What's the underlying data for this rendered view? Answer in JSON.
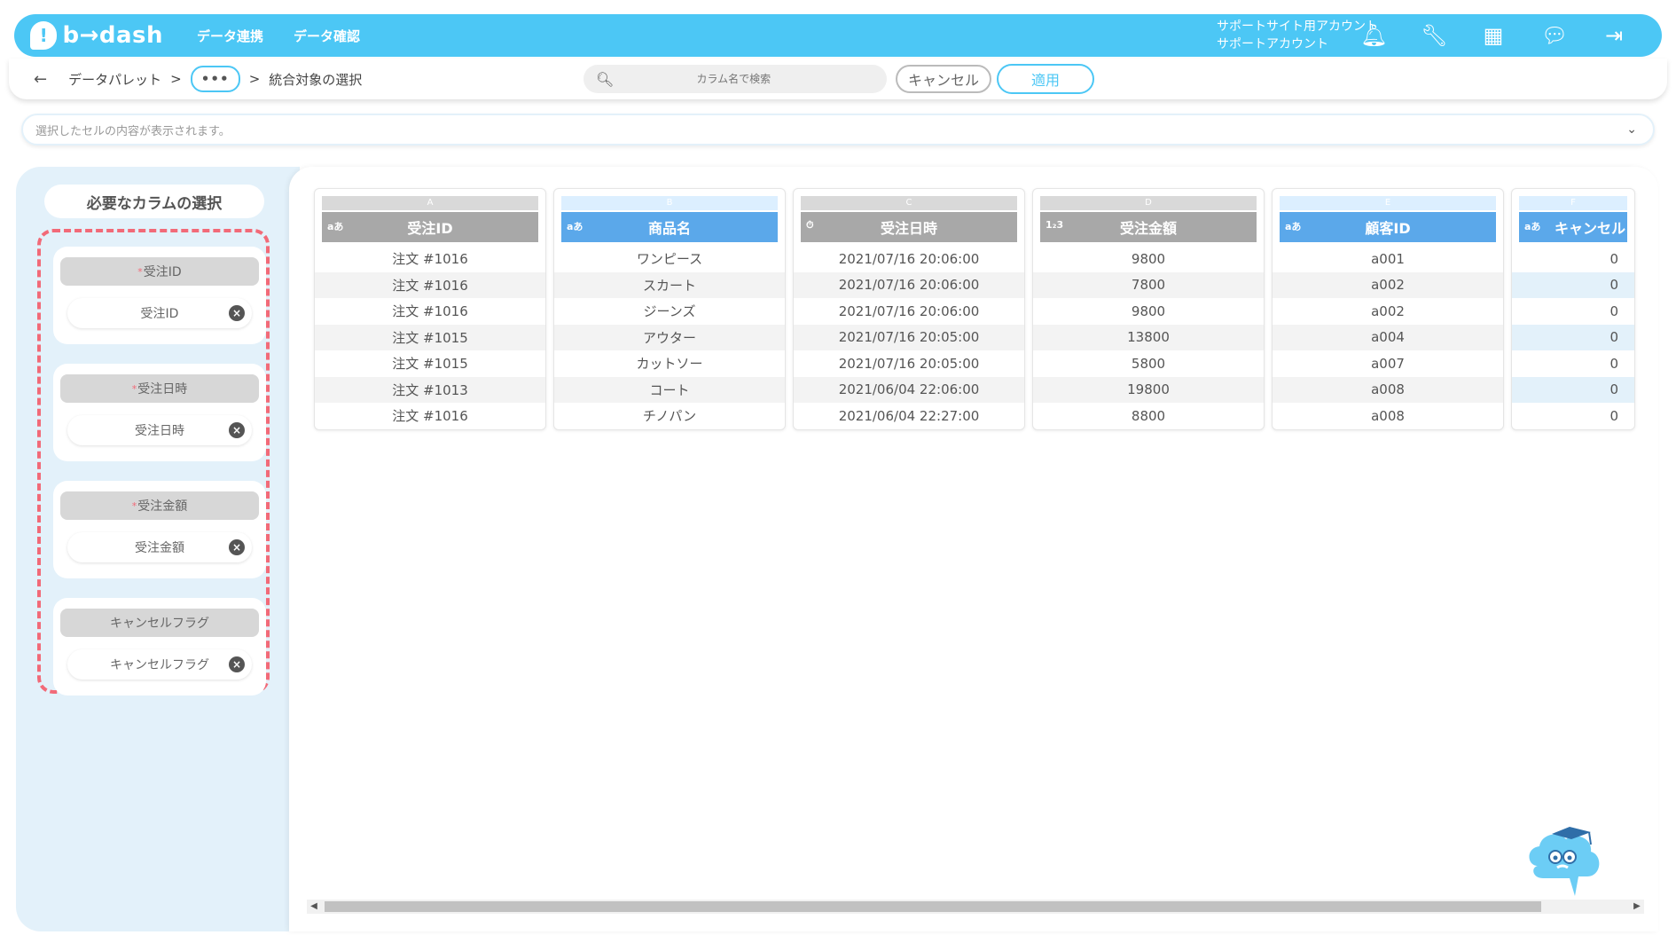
{
  "header": {
    "logo_text": "b→dash",
    "nav": [
      "データ連携",
      "データ確認"
    ],
    "account_line1": "サポートサイト用アカウント",
    "account_line2": "サポートアカウント"
  },
  "breadcrumb": {
    "items": [
      "データパレット",
      "•••",
      "統合対象の選択"
    ],
    "separator": ">"
  },
  "search": {
    "placeholder": "カラム名で検索"
  },
  "actions": {
    "cancel_label": "キャンセル",
    "apply_label": "適用"
  },
  "cell_preview": {
    "text": "選択したセルの内容が表示されます。"
  },
  "left_panel": {
    "title": "必要なカラムの選択",
    "groups": [
      {
        "label": "受注ID",
        "required": true,
        "selected": "受注ID"
      },
      {
        "label": "受注日時",
        "required": true,
        "selected": "受注日時"
      },
      {
        "label": "受注金額",
        "required": true,
        "selected": "受注金額"
      },
      {
        "label": "キャンセルフラグ",
        "required": false,
        "selected": "キャンセルフラグ"
      }
    ],
    "required_mark": "*"
  },
  "table": {
    "columns": [
      {
        "letter": "A",
        "name": "受注ID",
        "type_icon": "aあ",
        "selected": false,
        "align": "center"
      },
      {
        "letter": "B",
        "name": "商品名",
        "type_icon": "aあ",
        "selected": true,
        "align": "center"
      },
      {
        "letter": "C",
        "name": "受注日時",
        "type_icon": "⏱",
        "selected": false,
        "align": "center"
      },
      {
        "letter": "D",
        "name": "受注金額",
        "type_icon": "1₂3",
        "selected": false,
        "align": "center"
      },
      {
        "letter": "E",
        "name": "顧客ID",
        "type_icon": "aあ",
        "selected": true,
        "align": "center"
      },
      {
        "letter": "F",
        "name": "キャンセル",
        "type_icon": "aあ",
        "selected": true,
        "align": "right"
      }
    ],
    "rows": [
      [
        "注文 #1016",
        "ワンピース",
        "2021/07/16 20:06:00",
        "9800",
        "a001",
        "0"
      ],
      [
        "注文 #1016",
        "スカート",
        "2021/07/16 20:06:00",
        "7800",
        "a002",
        "0"
      ],
      [
        "注文 #1016",
        "ジーンズ",
        "2021/07/16 20:06:00",
        "9800",
        "a002",
        "0"
      ],
      [
        "注文 #1015",
        "アウター",
        "2021/07/16 20:05:00",
        "13800",
        "a004",
        "0"
      ],
      [
        "注文 #1015",
        "カットソー",
        "2021/07/16 20:05:00",
        "5800",
        "a007",
        "0"
      ],
      [
        "注文 #1013",
        "コート",
        "2021/06/04 22:06:00",
        "19800",
        "a008",
        "0"
      ],
      [
        "注文 #1016",
        "チノパン",
        "2021/06/04 22:27:00",
        "8800",
        "a008",
        "0"
      ]
    ]
  },
  "colors": {
    "brand": "#4cc7f5",
    "selected_header": "#5ba8ea",
    "dashed_outline": "#f26a78",
    "panel_bg": "#e3f1fa"
  }
}
